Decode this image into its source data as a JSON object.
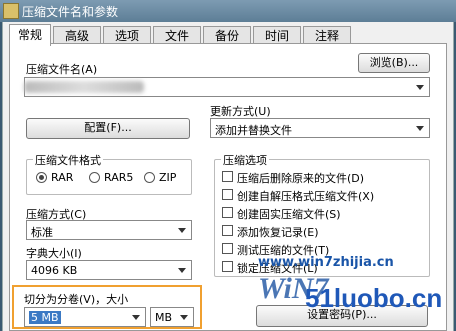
{
  "window": {
    "title": "压缩文件名和参数"
  },
  "tabs": [
    "常规",
    "高级",
    "选项",
    "文件",
    "备份",
    "时间",
    "注释"
  ],
  "general": {
    "archive_name_label": "压缩文件名(A)",
    "browse_button": "浏览(B)...",
    "update_mode_label": "更新方式(U)",
    "update_mode_value": "添加并替换文件",
    "profiles_button": "配置(F)...",
    "format_group": "压缩文件格式",
    "formats": [
      "RAR",
      "RAR5",
      "ZIP"
    ],
    "selected_format": "RAR",
    "method_label": "压缩方式(C)",
    "method_value": "标准",
    "dict_label": "字典大小(I)",
    "dict_value": "4096 KB",
    "split_label": "切分为分卷(V)，大小",
    "split_value": "5 MB",
    "split_unit": "MB",
    "options_group": "压缩选项",
    "options": [
      "压缩后删除原来的文件(D)",
      "创建自解压格式压缩文件(X)",
      "创建固实压缩文件(S)",
      "添加恢复记录(E)",
      "测试压缩的文件(T)",
      "锁定压缩文件(L)"
    ],
    "set_password_button": "设置密码(P)..."
  },
  "watermarks": {
    "site1": "www.win7zhijia.cn",
    "logo": "WiN7",
    "site2": "51luobo.cn"
  }
}
